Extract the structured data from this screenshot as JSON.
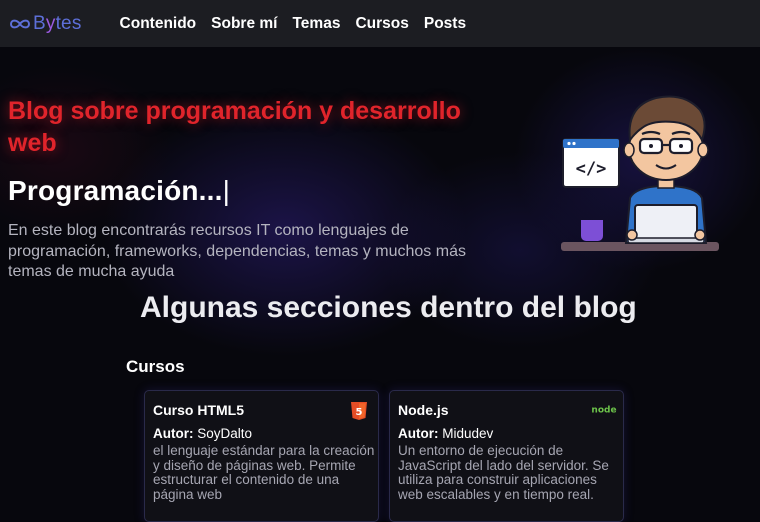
{
  "brand": {
    "prefix": "B",
    "middle": "y",
    "rest": "tes"
  },
  "nav": {
    "items": [
      "Contenido",
      "Sobre mí",
      "Temas",
      "Cursos",
      "Posts"
    ]
  },
  "hero": {
    "title": "Blog sobre programación y desarrollo web",
    "typed_text": "Programación...",
    "cursor": "|",
    "description": "En este blog encontrarás recursos IT como lenguajes de programación, frameworks, dependencias, temas y muchos más temas de mucha ayuda",
    "illustration": {
      "code_label": "</>"
    }
  },
  "sections": {
    "heading": "Algunas secciones dentro del blog",
    "category": "Cursos",
    "cards": [
      {
        "title": "Curso HTML5",
        "author_label": "Autor:",
        "author": "SoyDalto",
        "description": "el lenguaje estándar para la creación y diseño de páginas web. Permite estructurar el contenido de una página web",
        "icon": "html5-icon",
        "icon_text": "5"
      },
      {
        "title": "Node.js",
        "author_label": "Autor:",
        "author": "Midudev",
        "description": "Un entorno de ejecución de JavaScript del lado del servidor. Se utiliza para construir aplicaciones web escalables y en tiempo real.",
        "icon": "nodejs-icon",
        "icon_text": "node"
      }
    ]
  },
  "colors": {
    "navbar_bg": "#1c1d22",
    "accent_red": "#e0242b",
    "brand_blue": "#5d6fd8",
    "brand_purple": "#9b5ae0",
    "html5_orange": "#e44d26",
    "node_green": "#6cc24a"
  }
}
